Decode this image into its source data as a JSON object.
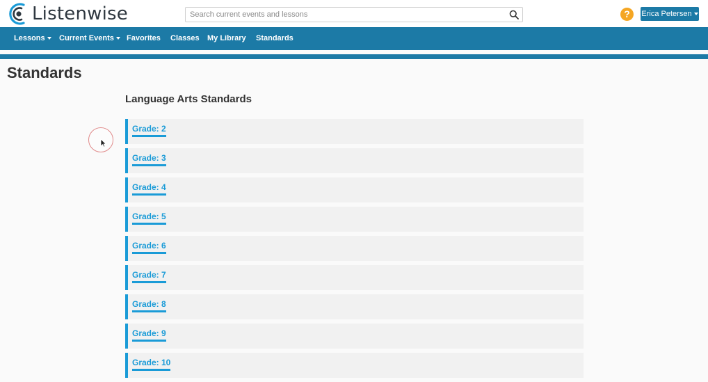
{
  "header": {
    "brand": "Listenwise",
    "search_placeholder": "Search current events and lessons",
    "help_label": "?",
    "user_name": "Erica Petersen"
  },
  "nav": {
    "items": [
      {
        "label": "Lessons",
        "has_menu": true
      },
      {
        "label": "Current Events",
        "has_menu": true
      },
      {
        "label": "Favorites",
        "has_menu": false
      },
      {
        "label": "Classes",
        "has_menu": false
      },
      {
        "label": "My Library",
        "has_menu": false
      },
      {
        "label": "Standards",
        "has_menu": false
      }
    ]
  },
  "main": {
    "page_title": "Standards",
    "section_title": "Language Arts Standards",
    "grades": [
      {
        "label": "Grade: 2"
      },
      {
        "label": "Grade: 3"
      },
      {
        "label": "Grade: 4"
      },
      {
        "label": "Grade: 5"
      },
      {
        "label": "Grade: 6"
      },
      {
        "label": "Grade: 7"
      },
      {
        "label": "Grade: 8"
      },
      {
        "label": "Grade: 9"
      },
      {
        "label": "Grade: 10"
      }
    ]
  },
  "colors": {
    "brand_blue": "#1c7aa6",
    "link_blue": "#1a9bd7",
    "help_orange": "#f5a623"
  },
  "icons": {
    "search": "search-icon",
    "logo": "listenwise-logo-icon",
    "cursor": "mouse-cursor-icon"
  }
}
